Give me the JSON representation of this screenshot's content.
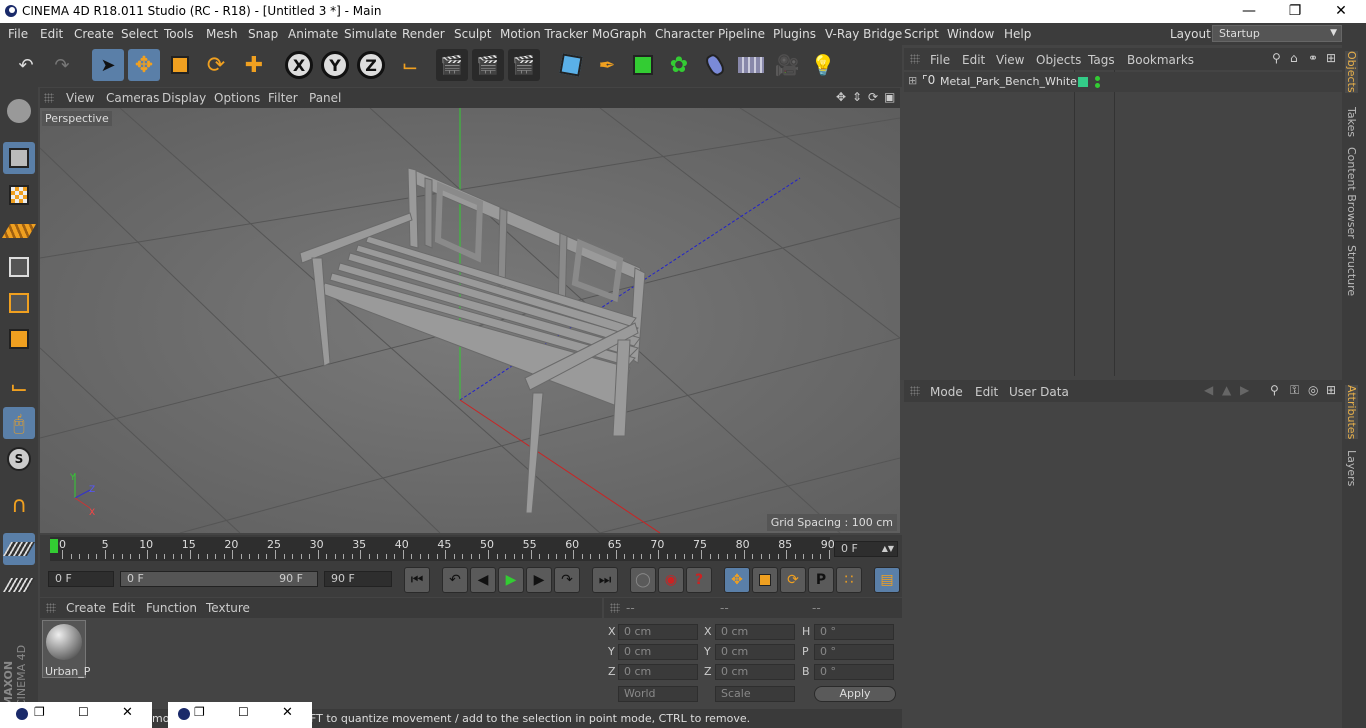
{
  "window": {
    "title": "CINEMA 4D R18.011 Studio (RC - R18) - [Untitled 3 *] - Main"
  },
  "menubar": {
    "items": [
      "File",
      "Edit",
      "Create",
      "Select",
      "Tools",
      "Mesh",
      "Snap",
      "Animate",
      "Simulate",
      "Render",
      "Sculpt",
      "Motion Tracker",
      "MoGraph",
      "Character",
      "Pipeline",
      "Plugins",
      "V-Ray Bridge",
      "Script",
      "Window",
      "Help"
    ],
    "layout_label": "Layout:",
    "layout_value": "Startup"
  },
  "toolbar": {
    "axis_x": "X",
    "axis_y": "Y",
    "axis_z": "Z"
  },
  "viewport": {
    "menu": [
      "View",
      "Cameras",
      "Display",
      "Options",
      "Filter",
      "Panel"
    ],
    "camera_label": "Perspective",
    "grid_spacing": "Grid Spacing : 100 cm"
  },
  "timeline": {
    "ticks": [
      "0",
      "5",
      "10",
      "15",
      "20",
      "25",
      "30",
      "35",
      "40",
      "45",
      "50",
      "55",
      "60",
      "65",
      "70",
      "75",
      "80",
      "85",
      "90"
    ],
    "current_frame": "0 F"
  },
  "transport": {
    "start_field": "0 F",
    "range_start": "0 F",
    "range_end": "90 F",
    "end_field": "90 F"
  },
  "material_manager": {
    "menu": [
      "Create",
      "Edit",
      "Function",
      "Texture"
    ],
    "materials": [
      {
        "name": "Urban_P"
      }
    ]
  },
  "coordinates": {
    "header_dashes": [
      "--",
      "--",
      "--"
    ],
    "rows": [
      {
        "l1": "X",
        "v1": "0 cm",
        "l2": "X",
        "v2": "0 cm",
        "l3": "H",
        "v3": "0 °"
      },
      {
        "l1": "Y",
        "v1": "0 cm",
        "l2": "Y",
        "v2": "0 cm",
        "l3": "P",
        "v3": "0 °"
      },
      {
        "l1": "Z",
        "v1": "0 cm",
        "l2": "Z",
        "v2": "0 cm",
        "l3": "B",
        "v3": "0 °"
      }
    ],
    "space": "World",
    "mode": "Scale",
    "apply": "Apply"
  },
  "object_manager": {
    "menu": [
      "File",
      "Edit",
      "View",
      "Objects",
      "Tags",
      "Bookmarks"
    ],
    "objects": [
      {
        "name": "Metal_Park_Bench_White"
      }
    ]
  },
  "attributes": {
    "menu": [
      "Mode",
      "Edit",
      "User Data"
    ]
  },
  "right_tabs": [
    "Objects",
    "Takes",
    "Content Browser",
    "Structure"
  ],
  "right_tabs_lower": [
    "Attributes",
    "Layers"
  ],
  "status": {
    "text": "FT to quantize movement / add to the selection in point mode, CTRL to remove.",
    "prefix": "mo"
  },
  "branding": {
    "maxon": "MAXON",
    "product": "CINEMA 4D"
  }
}
